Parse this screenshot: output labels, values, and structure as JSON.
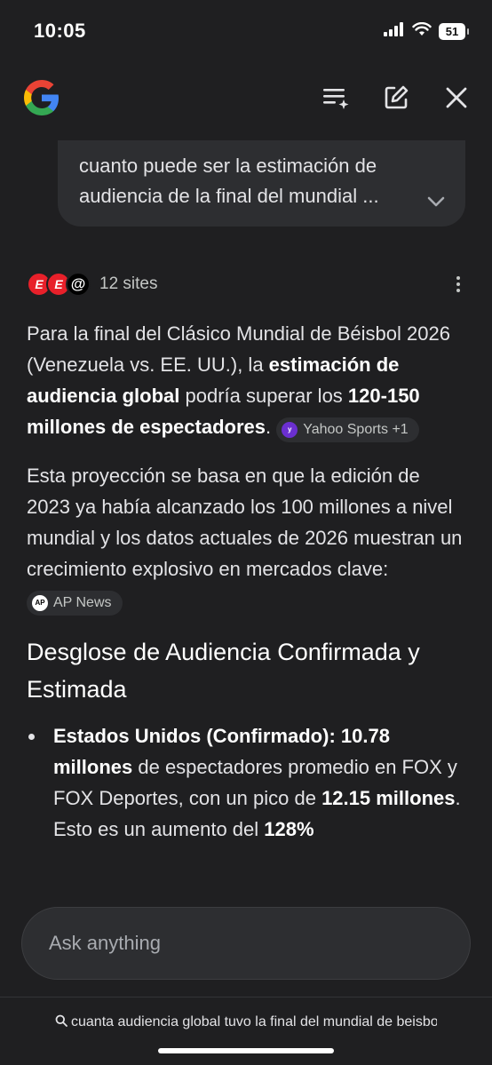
{
  "status_bar": {
    "time": "10:05",
    "battery": "51"
  },
  "query": {
    "text": "cuanto puede ser la estimación de audiencia de la final del mundial ..."
  },
  "sources": {
    "count_label": "12 sites",
    "icons": [
      "espn-icon",
      "espn-icon",
      "threads-icon"
    ]
  },
  "answer": {
    "p1": {
      "t1": "Para la final del Clásico Mundial de Béisbol 2026 (Venezuela vs. EE. UU.), la ",
      "b1": "estimación de audiencia global",
      "t2": " podría superar los ",
      "b2": "120-150 millones de espectadores",
      "t3": ". ",
      "chip": "Yahoo Sports +1"
    },
    "p2": {
      "text": "Esta proyección se basa en que la edición de 2023 ya había alcanzado los 100 millones a nivel mundial y los datos actuales de 2026 muestran un crecimiento explosivo en mercados clave: ",
      "chip": "AP News"
    },
    "section_title": "Desglose de Audiencia Confirmada y Estimada",
    "bullet1": {
      "b1": "Estados Unidos (Confirmado): 10.78 millones",
      "t1": " de espectadores promedio en FOX y FOX Deportes, con un pico de ",
      "b2": "12.15 millones",
      "t2": ". Esto es un aumento del ",
      "b3": "128%"
    }
  },
  "ask": {
    "placeholder": "Ask anything"
  },
  "suggestion": {
    "text": "cuanta audiencia global tuvo la final del mundial de beisbol"
  },
  "colors": {
    "background": "#1f1f21",
    "surface": "#2d2e31",
    "text": "#e3e3e6",
    "espn_red": "#e8202a",
    "yahoo_purple": "#6b2fd0"
  }
}
